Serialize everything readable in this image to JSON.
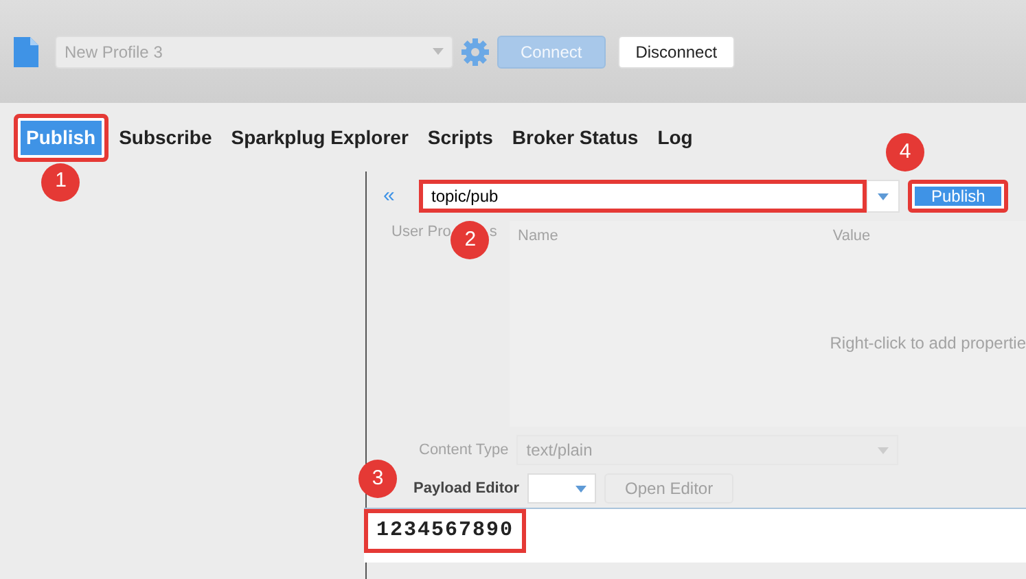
{
  "toolbar": {
    "profile": {
      "value": "New Profile 3",
      "disabled": true
    },
    "connect": {
      "label": "Connect",
      "disabled": true
    },
    "disconnect": {
      "label": "Disconnect",
      "disabled": false
    }
  },
  "tabs": [
    {
      "label": "Publish",
      "selected": true,
      "highlighted": true,
      "annotation": "1"
    },
    {
      "label": "Subscribe",
      "selected": false,
      "highlighted": false
    },
    {
      "label": "Sparkplug Explorer",
      "selected": false,
      "highlighted": false
    },
    {
      "label": "Scripts",
      "selected": false,
      "highlighted": false
    },
    {
      "label": "Broker Status",
      "selected": false,
      "highlighted": false
    },
    {
      "label": "Log",
      "selected": false,
      "highlighted": false
    }
  ],
  "publish": {
    "collapse": "«",
    "topic": {
      "value": "topic/pub",
      "highlighted": true,
      "annotation": "2"
    },
    "button": {
      "label": "Publish",
      "highlighted": true,
      "annotation": "4"
    },
    "user_properties": {
      "label_start": "User Pro",
      "label_end": "s",
      "columns": [
        "Name",
        "Value"
      ],
      "hint": "Right-click to add propertie"
    },
    "content_type": {
      "label": "Content Type",
      "value": "text/plain",
      "disabled": true
    },
    "payload_editor": {
      "label": "Payload Editor",
      "button": "Open Editor"
    },
    "payload": {
      "value": "1234567890",
      "highlighted": true,
      "annotation": "3"
    }
  }
}
